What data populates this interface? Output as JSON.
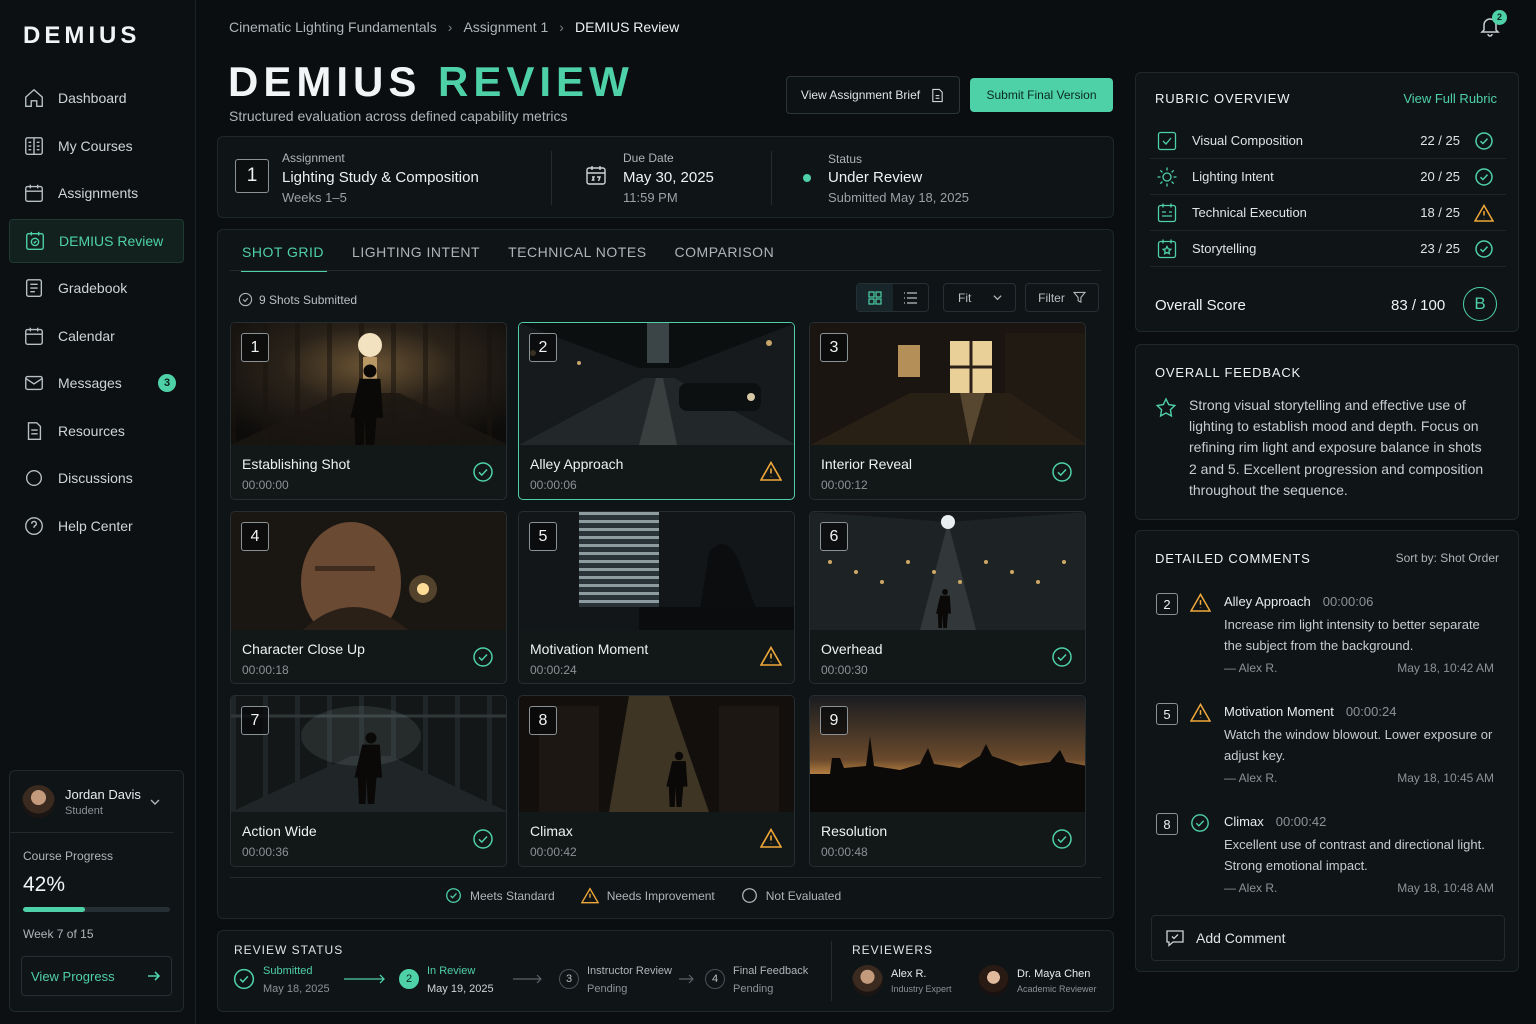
{
  "app": {
    "logo": "DEMIUS"
  },
  "sidebar": {
    "items": [
      {
        "label": "Dashboard",
        "icon": "home-icon"
      },
      {
        "label": "My Courses",
        "icon": "book-icon"
      },
      {
        "label": "Assignments",
        "icon": "calendar-icon"
      },
      {
        "label": "DEMIUS Review",
        "icon": "review-icon"
      },
      {
        "label": "Gradebook",
        "icon": "gradebook-icon"
      },
      {
        "label": "Calendar",
        "icon": "calendar-icon"
      },
      {
        "label": "Messages",
        "icon": "mail-icon",
        "badge": "3"
      },
      {
        "label": "Resources",
        "icon": "document-icon"
      },
      {
        "label": "Discussions",
        "icon": "chat-icon"
      },
      {
        "label": "Help Center",
        "icon": "help-icon"
      }
    ],
    "active_index": 3
  },
  "user": {
    "name": "Jordan Davis",
    "role": "Student",
    "progress_label": "Course Progress",
    "progress_value": "42%",
    "progress_fraction": 0.42,
    "week": "Week 7 of 15",
    "view_progress": "View Progress"
  },
  "header": {
    "breadcrumb": [
      "Cinematic Lighting Fundamentals",
      "Assignment 1",
      "DEMIUS Review"
    ],
    "notifications": "2",
    "title_main": "DEMIUS",
    "title_accent": "REVIEW",
    "subtitle": "Structured evaluation across defined capability metrics",
    "brief_button": "View Assignment Brief",
    "submit_button": "Submit Final Version"
  },
  "info": {
    "assignment_number": "1",
    "assignment_label": "Assignment",
    "assignment_name": "Lighting Study & Composition",
    "assignment_weeks": "Weeks 1–5",
    "due_label": "Due Date",
    "due_date": "May 30, 2025",
    "due_time": "11:59 PM",
    "status_label": "Status",
    "status_value": "Under Review",
    "status_sub": "Submitted May 18, 2025"
  },
  "grid": {
    "tabs": [
      "SHOT GRID",
      "LIGHTING INTENT",
      "TECHNICAL NOTES",
      "COMPARISON"
    ],
    "shots_count": "9 Shots Submitted",
    "fit": "Fit",
    "filter": "Filter",
    "shots": [
      {
        "num": "1",
        "title": "Establishing Shot",
        "time": "00:00:00",
        "status": "meets"
      },
      {
        "num": "2",
        "title": "Alley Approach",
        "time": "00:00:06",
        "status": "needs"
      },
      {
        "num": "3",
        "title": "Interior Reveal",
        "time": "00:00:12",
        "status": "meets"
      },
      {
        "num": "4",
        "title": "Character Close Up",
        "time": "00:00:18",
        "status": "meets"
      },
      {
        "num": "5",
        "title": "Motivation Moment",
        "time": "00:00:24",
        "status": "needs"
      },
      {
        "num": "6",
        "title": "Overhead",
        "time": "00:00:30",
        "status": "meets"
      },
      {
        "num": "7",
        "title": "Action Wide",
        "time": "00:00:36",
        "status": "meets"
      },
      {
        "num": "8",
        "title": "Climax",
        "time": "00:00:42",
        "status": "needs"
      },
      {
        "num": "9",
        "title": "Resolution",
        "time": "00:00:48",
        "status": "meets"
      }
    ],
    "legend": [
      "Meets Standard",
      "Needs Improvement",
      "Not Evaluated"
    ]
  },
  "review_status": {
    "heading": "REVIEW STATUS",
    "steps": [
      {
        "num": "",
        "name": "Submitted",
        "date": "May 18, 2025"
      },
      {
        "num": "2",
        "name": "In Review",
        "date": "May 19, 2025"
      },
      {
        "num": "3",
        "name": "Instructor Review",
        "date": "Pending"
      },
      {
        "num": "4",
        "name": "Final Feedback",
        "date": "Pending"
      }
    ],
    "reviewers_heading": "REVIEWERS",
    "reviewers": [
      {
        "name": "Alex R.",
        "role": "Industry Expert"
      },
      {
        "name": "Dr. Maya Chen",
        "role": "Academic Reviewer"
      }
    ]
  },
  "rubric": {
    "heading": "RUBRIC OVERVIEW",
    "link": "View Full Rubric",
    "rows": [
      {
        "label": "Visual Composition",
        "score": "22 / 25",
        "status": "meets"
      },
      {
        "label": "Lighting Intent",
        "score": "20 / 25",
        "status": "meets"
      },
      {
        "label": "Technical Execution",
        "score": "18 / 25",
        "status": "needs"
      },
      {
        "label": "Storytelling",
        "score": "23 / 25",
        "status": "meets"
      }
    ],
    "overall_label": "Overall Score",
    "overall_score": "83 / 100",
    "grade": "B"
  },
  "feedback": {
    "heading": "OVERALL FEEDBACK",
    "text": "Strong visual storytelling and effective use of lighting to establish mood and depth. Focus on refining rim light and exposure balance in shots 2 and 5. Excellent progression and composition throughout the sequence."
  },
  "comments": {
    "heading": "DETAILED COMMENTS",
    "sort": "Sort by: Shot Order",
    "items": [
      {
        "num": "2",
        "status": "needs",
        "title": "Alley Approach",
        "time": "00:00:06",
        "body": "Increase rim light intensity to better separate the subject from the background.",
        "author": "— Alex R.",
        "date": "May 18, 10:42 AM"
      },
      {
        "num": "5",
        "status": "needs",
        "title": "Motivation Moment",
        "time": "00:00:24",
        "body": "Watch the window blowout. Lower exposure or adjust key.",
        "author": "— Alex R.",
        "date": "May 18, 10:45 AM"
      },
      {
        "num": "8",
        "status": "meets",
        "title": "Climax",
        "time": "00:00:42",
        "body": "Excellent use of contrast and directional light. Strong emotional impact.",
        "author": "— Alex R.",
        "date": "May 18, 10:48 AM"
      }
    ],
    "add_label": "Add Comment"
  },
  "colors": {
    "accent": "#4fd1a7",
    "warning": "#f0a83a",
    "background": "#0b0e10"
  }
}
